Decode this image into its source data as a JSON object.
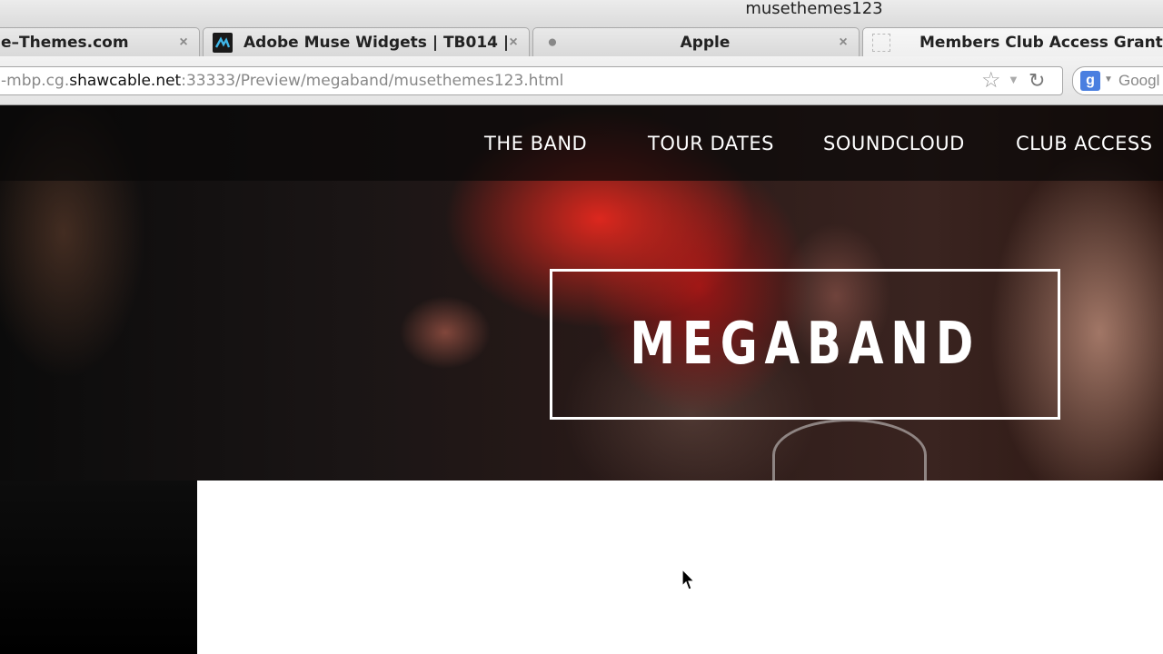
{
  "window": {
    "title": "musethemes123"
  },
  "tabs": [
    {
      "label": "e–Themes.com",
      "favicon": "none",
      "active": false
    },
    {
      "label": "Adobe Muse Widgets | TB014 | …",
      "favicon": "muse-icon",
      "active": false
    },
    {
      "label": "Apple",
      "favicon": "apple-icon",
      "active": false
    },
    {
      "label": "Members Club Access Granted!",
      "favicon": "blank-page-icon",
      "active": true
    }
  ],
  "toolbar": {
    "url_prefix": "-mbp.cg.",
    "url_domain": "shawcable.net",
    "url_rest": ":33333/Preview/megaband/musethemes123.html",
    "search_placeholder": "Googl"
  },
  "site": {
    "nav": [
      "THE BAND",
      "TOUR DATES",
      "SOUNDCLOUD",
      "CLUB ACCESS"
    ],
    "logo": "MEGABAND"
  }
}
